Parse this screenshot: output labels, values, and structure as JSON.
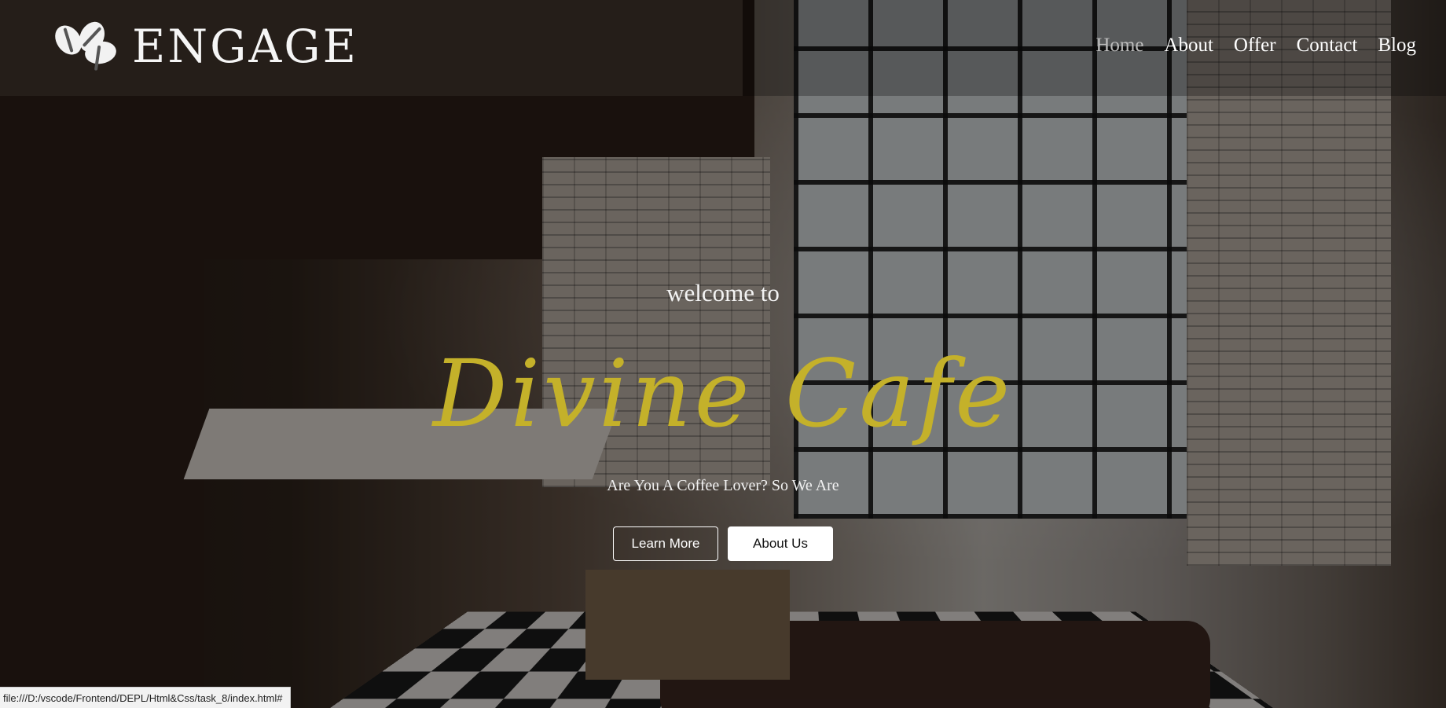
{
  "brand": {
    "name": "ENGAGE",
    "logo_icon": "coffee-beans-icon"
  },
  "nav": {
    "items": [
      {
        "label": "Home",
        "active": true
      },
      {
        "label": "About",
        "active": false
      },
      {
        "label": "Offer",
        "active": false
      },
      {
        "label": "Contact",
        "active": false
      },
      {
        "label": "Blog",
        "active": false
      }
    ]
  },
  "hero": {
    "welcome": "welcome to",
    "title": "Divine Cafe",
    "tagline": "Are You A Coffee Lover? So We Are",
    "buttons": {
      "learn_more": "Learn More",
      "about_us": "About Us"
    }
  },
  "status_bar": {
    "url": "file:///D:/vscode/Frontend/DEPL/Html&Css/task_8/index.html#"
  },
  "colors": {
    "title": "#c4b12a",
    "nav_active": "#bdbdbd",
    "text": "#ffffff"
  }
}
